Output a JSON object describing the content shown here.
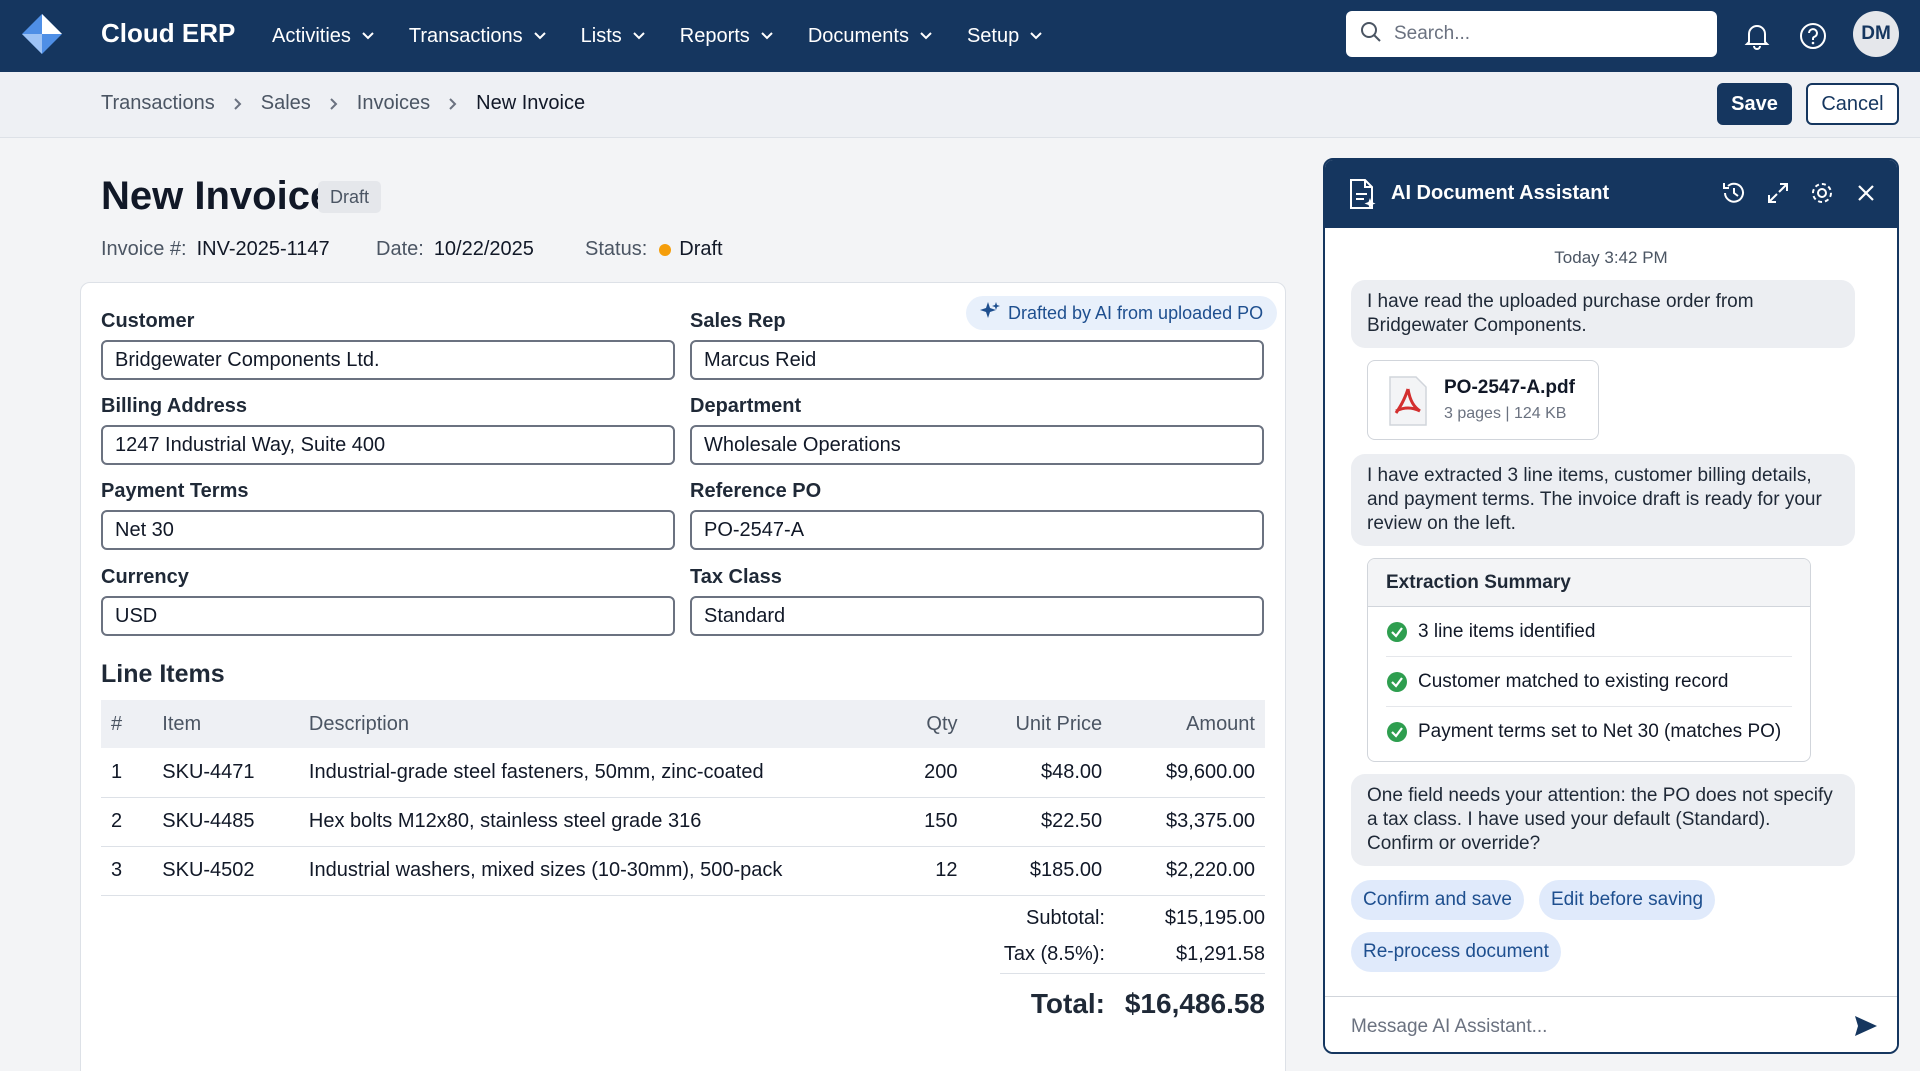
{
  "app": {
    "brand": "Cloud ERP",
    "menu": [
      {
        "label": "Activities"
      },
      {
        "label": "Transactions"
      },
      {
        "label": "Lists"
      },
      {
        "label": "Reports"
      },
      {
        "label": "Documents"
      },
      {
        "label": "Setup"
      }
    ],
    "search_placeholder": "Search...",
    "user_initials": "DM",
    "accent_color": "#15365f"
  },
  "breadcrumb": [
    "Transactions",
    "Sales",
    "Invoices",
    "New Invoice"
  ],
  "toolbar": {
    "save_label": "Save",
    "cancel_label": "Cancel"
  },
  "invoice": {
    "title": "New Invoice",
    "badge": "Draft",
    "number_label": "Invoice #:",
    "number": "INV-2025-1147",
    "date_label": "Date:",
    "date": "10/22/2025",
    "status_label": "Status:",
    "status": "Draft",
    "ai_chip": "Drafted by AI from uploaded PO",
    "fields": {
      "customer": {
        "label": "Customer",
        "value": "Bridgewater Components Ltd."
      },
      "sales_rep": {
        "label": "Sales Rep",
        "value": "Marcus Reid"
      },
      "billing_address": {
        "label": "Billing Address",
        "value": "1247 Industrial Way, Suite 400"
      },
      "department": {
        "label": "Department",
        "value": "Wholesale Operations"
      },
      "payment_terms": {
        "label": "Payment Terms",
        "value": "Net 30"
      },
      "reference_po": {
        "label": "Reference PO",
        "value": "PO-2547-A"
      },
      "currency": {
        "label": "Currency",
        "value": "USD"
      },
      "tax_class": {
        "label": "Tax Class",
        "value": "Standard"
      }
    },
    "line_items_title": "Line Items",
    "columns": [
      "#",
      "Item",
      "Description",
      "Qty",
      "Unit Price",
      "Amount"
    ],
    "lines": [
      [
        "1",
        "SKU-4471",
        "Industrial-grade steel fasteners, 50mm, zinc-coated",
        "200",
        "$48.00",
        "$9,600.00"
      ],
      [
        "2",
        "SKU-4485",
        "Hex bolts M12x80, stainless steel grade 316",
        "150",
        "$22.50",
        "$3,375.00"
      ],
      [
        "3",
        "SKU-4502",
        "Industrial washers, mixed sizes (10-30mm), 500-pack",
        "12",
        "$185.00",
        "$2,220.00"
      ]
    ],
    "subtotal_label": "Subtotal:",
    "subtotal": "$15,195.00",
    "tax_label": "Tax (8.5%):",
    "tax": "$1,291.58",
    "total_label": "Total:",
    "total": "$16,486.58"
  },
  "assistant": {
    "title": "AI Document Assistant",
    "timestamp": "Today 3:42 PM",
    "msg1": "I have read the uploaded purchase order from Bridgewater Components.",
    "file_name": "PO-2547-A.pdf",
    "file_meta": "3 pages | 124 KB",
    "msg2": "I have extracted 3 line items, customer billing details, and payment terms. The invoice draft is ready for your review on the left.",
    "summary_title": "Extraction Summary",
    "summary_items": [
      "3 line items identified",
      "Customer matched to existing record",
      "Payment terms set to Net 30 (matches PO)"
    ],
    "msg3": "One field needs your attention: the PO does not specify a tax class. I have used your default (Standard). Confirm or override?",
    "actions": [
      "Confirm and save",
      "Edit before saving",
      "Re-process document"
    ],
    "composer_placeholder": "Message AI Assistant..."
  }
}
